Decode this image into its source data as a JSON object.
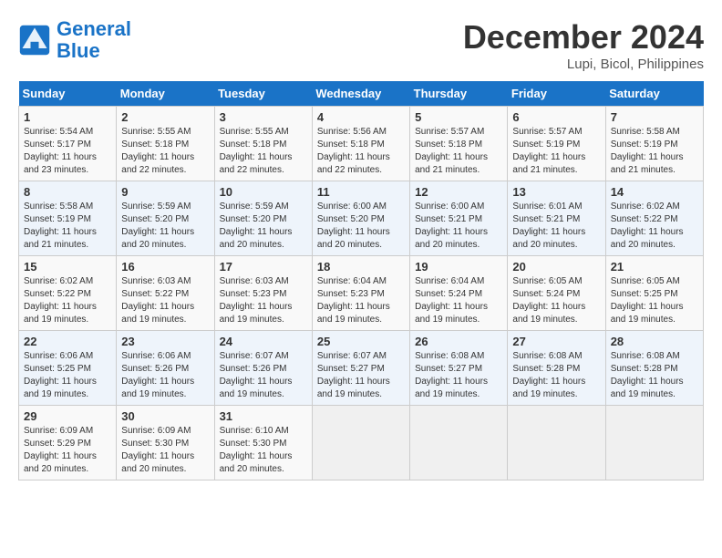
{
  "header": {
    "logo_general": "General",
    "logo_blue": "Blue",
    "month_year": "December 2024",
    "location": "Lupi, Bicol, Philippines"
  },
  "days_of_week": [
    "Sunday",
    "Monday",
    "Tuesday",
    "Wednesday",
    "Thursday",
    "Friday",
    "Saturday"
  ],
  "weeks": [
    [
      {
        "day": "1",
        "info": "Sunrise: 5:54 AM\nSunset: 5:17 PM\nDaylight: 11 hours\nand 23 minutes."
      },
      {
        "day": "2",
        "info": "Sunrise: 5:55 AM\nSunset: 5:18 PM\nDaylight: 11 hours\nand 22 minutes."
      },
      {
        "day": "3",
        "info": "Sunrise: 5:55 AM\nSunset: 5:18 PM\nDaylight: 11 hours\nand 22 minutes."
      },
      {
        "day": "4",
        "info": "Sunrise: 5:56 AM\nSunset: 5:18 PM\nDaylight: 11 hours\nand 22 minutes."
      },
      {
        "day": "5",
        "info": "Sunrise: 5:57 AM\nSunset: 5:18 PM\nDaylight: 11 hours\nand 21 minutes."
      },
      {
        "day": "6",
        "info": "Sunrise: 5:57 AM\nSunset: 5:19 PM\nDaylight: 11 hours\nand 21 minutes."
      },
      {
        "day": "7",
        "info": "Sunrise: 5:58 AM\nSunset: 5:19 PM\nDaylight: 11 hours\nand 21 minutes."
      }
    ],
    [
      {
        "day": "8",
        "info": "Sunrise: 5:58 AM\nSunset: 5:19 PM\nDaylight: 11 hours\nand 21 minutes."
      },
      {
        "day": "9",
        "info": "Sunrise: 5:59 AM\nSunset: 5:20 PM\nDaylight: 11 hours\nand 20 minutes."
      },
      {
        "day": "10",
        "info": "Sunrise: 5:59 AM\nSunset: 5:20 PM\nDaylight: 11 hours\nand 20 minutes."
      },
      {
        "day": "11",
        "info": "Sunrise: 6:00 AM\nSunset: 5:20 PM\nDaylight: 11 hours\nand 20 minutes."
      },
      {
        "day": "12",
        "info": "Sunrise: 6:00 AM\nSunset: 5:21 PM\nDaylight: 11 hours\nand 20 minutes."
      },
      {
        "day": "13",
        "info": "Sunrise: 6:01 AM\nSunset: 5:21 PM\nDaylight: 11 hours\nand 20 minutes."
      },
      {
        "day": "14",
        "info": "Sunrise: 6:02 AM\nSunset: 5:22 PM\nDaylight: 11 hours\nand 20 minutes."
      }
    ],
    [
      {
        "day": "15",
        "info": "Sunrise: 6:02 AM\nSunset: 5:22 PM\nDaylight: 11 hours\nand 19 minutes."
      },
      {
        "day": "16",
        "info": "Sunrise: 6:03 AM\nSunset: 5:22 PM\nDaylight: 11 hours\nand 19 minutes."
      },
      {
        "day": "17",
        "info": "Sunrise: 6:03 AM\nSunset: 5:23 PM\nDaylight: 11 hours\nand 19 minutes."
      },
      {
        "day": "18",
        "info": "Sunrise: 6:04 AM\nSunset: 5:23 PM\nDaylight: 11 hours\nand 19 minutes."
      },
      {
        "day": "19",
        "info": "Sunrise: 6:04 AM\nSunset: 5:24 PM\nDaylight: 11 hours\nand 19 minutes."
      },
      {
        "day": "20",
        "info": "Sunrise: 6:05 AM\nSunset: 5:24 PM\nDaylight: 11 hours\nand 19 minutes."
      },
      {
        "day": "21",
        "info": "Sunrise: 6:05 AM\nSunset: 5:25 PM\nDaylight: 11 hours\nand 19 minutes."
      }
    ],
    [
      {
        "day": "22",
        "info": "Sunrise: 6:06 AM\nSunset: 5:25 PM\nDaylight: 11 hours\nand 19 minutes."
      },
      {
        "day": "23",
        "info": "Sunrise: 6:06 AM\nSunset: 5:26 PM\nDaylight: 11 hours\nand 19 minutes."
      },
      {
        "day": "24",
        "info": "Sunrise: 6:07 AM\nSunset: 5:26 PM\nDaylight: 11 hours\nand 19 minutes."
      },
      {
        "day": "25",
        "info": "Sunrise: 6:07 AM\nSunset: 5:27 PM\nDaylight: 11 hours\nand 19 minutes."
      },
      {
        "day": "26",
        "info": "Sunrise: 6:08 AM\nSunset: 5:27 PM\nDaylight: 11 hours\nand 19 minutes."
      },
      {
        "day": "27",
        "info": "Sunrise: 6:08 AM\nSunset: 5:28 PM\nDaylight: 11 hours\nand 19 minutes."
      },
      {
        "day": "28",
        "info": "Sunrise: 6:08 AM\nSunset: 5:28 PM\nDaylight: 11 hours\nand 19 minutes."
      }
    ],
    [
      {
        "day": "29",
        "info": "Sunrise: 6:09 AM\nSunset: 5:29 PM\nDaylight: 11 hours\nand 20 minutes."
      },
      {
        "day": "30",
        "info": "Sunrise: 6:09 AM\nSunset: 5:30 PM\nDaylight: 11 hours\nand 20 minutes."
      },
      {
        "day": "31",
        "info": "Sunrise: 6:10 AM\nSunset: 5:30 PM\nDaylight: 11 hours\nand 20 minutes."
      },
      {
        "day": "",
        "info": ""
      },
      {
        "day": "",
        "info": ""
      },
      {
        "day": "",
        "info": ""
      },
      {
        "day": "",
        "info": ""
      }
    ]
  ]
}
